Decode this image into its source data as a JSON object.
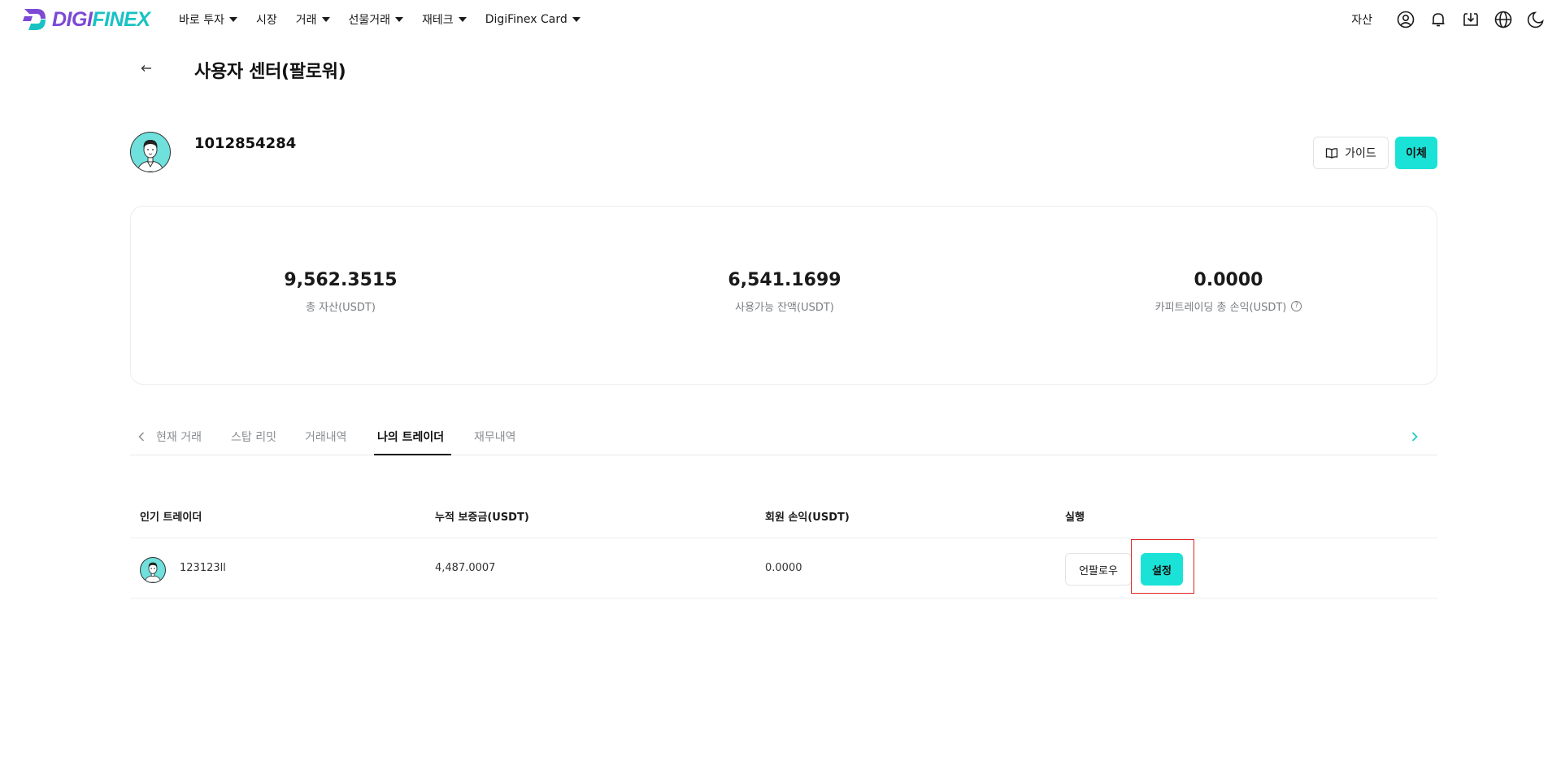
{
  "brand": {
    "logo_icon": "digifinex-logo-icon",
    "name_prefix": "DIGI",
    "name_suffix": "FINEX",
    "accent_color": "#1be2d6",
    "logo_purple": "#7b49d6",
    "logo_teal": "#18c2c4",
    "highlight_color": "#e02424"
  },
  "nav": {
    "items": [
      {
        "label": "바로 투자",
        "has_dropdown": true
      },
      {
        "label": "시장",
        "has_dropdown": false
      },
      {
        "label": "거래",
        "has_dropdown": true
      },
      {
        "label": "선물거래",
        "has_dropdown": true
      },
      {
        "label": "재테크",
        "has_dropdown": true
      },
      {
        "label": "DigiFinex Card",
        "has_dropdown": true
      }
    ],
    "right": {
      "assets_label": "자산",
      "icons": [
        "user-icon",
        "bell-icon",
        "download-icon",
        "globe-icon",
        "moon-icon"
      ]
    }
  },
  "page": {
    "back_icon": "arrow-left-icon",
    "title": "사용자 센터(팔로워)"
  },
  "profile": {
    "user_id": "1012854284",
    "guide_label": "가이드",
    "guide_icon": "book-icon",
    "transfer_label": "이체"
  },
  "stats": [
    {
      "value": "9,562.3515",
      "label": "총 자산(USDT)",
      "help": false
    },
    {
      "value": "6,541.1699",
      "label": "사용가능 잔액(USDT)",
      "help": false
    },
    {
      "value": "0.0000",
      "label": "카피트레이딩 총 손익(USDT)",
      "help": true,
      "help_icon": "question-circle-icon"
    }
  ],
  "tabs": {
    "items": [
      "현재 거래",
      "스탑 리밋",
      "거래내역",
      "나의 트레이더",
      "재무내역"
    ],
    "active_index": 3,
    "prev_icon": "chevron-left-icon",
    "next_icon": "chevron-right-icon"
  },
  "table": {
    "headers": [
      "인기 트레이더",
      "누적 보증금(USDT)",
      "회원 손익(USDT)",
      "실행"
    ],
    "rows": [
      {
        "trader": "123123ll",
        "deposit": "4,487.0007",
        "pnl": "0.0000",
        "unfollow_label": "언팔로우",
        "settings_label": "설정"
      }
    ]
  }
}
